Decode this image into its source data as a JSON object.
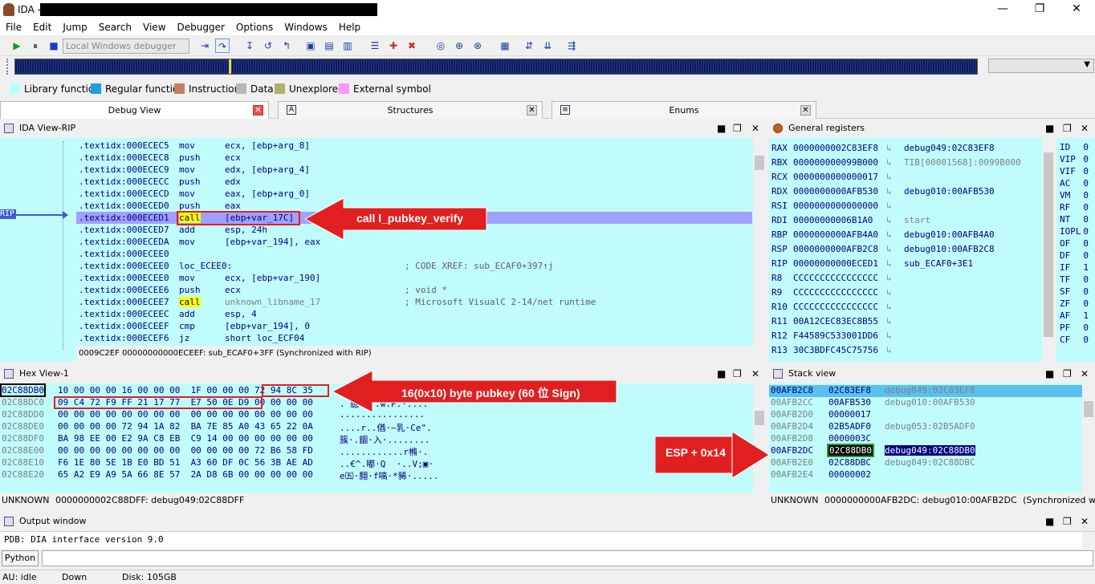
{
  "window": {
    "title": "IDA -",
    "minimize": "—",
    "maximize": "❐",
    "close": "✕"
  },
  "menu": [
    "File",
    "Edit",
    "Jump",
    "Search",
    "View",
    "Debugger",
    "Options",
    "Windows",
    "Help"
  ],
  "toolbar": {
    "debugger_select": "Local Windows debugger"
  },
  "legend": [
    {
      "label": "Library function",
      "color": "#b8ffff"
    },
    {
      "label": "Regular function",
      "color": "#1aa0e0"
    },
    {
      "label": "Instruction",
      "color": "#c08060"
    },
    {
      "label": "Data",
      "color": "#b8b8b8"
    },
    {
      "label": "Unexplored",
      "color": "#b0b070"
    },
    {
      "label": "External symbol",
      "color": "#ff98f8"
    }
  ],
  "tabs": [
    {
      "label": "Debug View"
    },
    {
      "label": "Structures"
    },
    {
      "label": "Enums"
    }
  ],
  "ida_view": {
    "title": "IDA View-RIP",
    "rip_label": "RIP",
    "lines": [
      {
        "addr": ".textidx:000ECEC5",
        "mn": "mov",
        "op": "ecx, [ebp+arg_8]",
        "cm": ""
      },
      {
        "addr": ".textidx:000ECEC8",
        "mn": "push",
        "op": "ecx",
        "cm": ""
      },
      {
        "addr": ".textidx:000ECEC9",
        "mn": "mov",
        "op": "edx, [ebp+arg_4]",
        "cm": ""
      },
      {
        "addr": ".textidx:000ECECC",
        "mn": "push",
        "op": "edx",
        "cm": ""
      },
      {
        "addr": ".textidx:000ECECD",
        "mn": "mov",
        "op": "eax, [ebp+arg_0]",
        "cm": ""
      },
      {
        "addr": ".textidx:000ECED0",
        "mn": "push",
        "op": "eax",
        "cm": ""
      },
      {
        "addr": ".textidx:000ECED1",
        "mn": "call",
        "op": "[ebp+var_17C]",
        "cm": ""
      },
      {
        "addr": ".textidx:000ECED7",
        "mn": "add",
        "op": "esp, 24h",
        "cm": ""
      },
      {
        "addr": ".textidx:000ECEDA",
        "mn": "mov",
        "op": "[ebp+var_194], eax",
        "cm": ""
      },
      {
        "addr": ".textidx:000ECEE0",
        "mn": "",
        "op": "",
        "cm": ""
      },
      {
        "addr": ".textidx:000ECEE0",
        "mn": "loc_ECEE0:",
        "op": "",
        "cm": "; CODE XREF: sub_ECAF0+397↑j"
      },
      {
        "addr": ".textidx:000ECEE0",
        "mn": "mov",
        "op": "ecx, [ebp+var_190]",
        "cm": ""
      },
      {
        "addr": ".textidx:000ECEE6",
        "mn": "push",
        "op": "ecx",
        "cm": "; void *"
      },
      {
        "addr": ".textidx:000ECEE7",
        "mn": "call",
        "op": "unknown_libname_17",
        "cm": "; Microsoft VisualC 2-14/net runtime"
      },
      {
        "addr": ".textidx:000ECEEC",
        "mn": "add",
        "op": "esp, 4",
        "cm": ""
      },
      {
        "addr": ".textidx:000ECEEF",
        "mn": "cmp",
        "op": "[ebp+var_194], 0",
        "cm": ""
      },
      {
        "addr": ".textidx:000ECEF6",
        "mn": "jz",
        "op": "short loc_ECF04",
        "cm": ""
      }
    ],
    "status": "0009C2EF 00000000000ECEEF: sub_ECAF0+3FF (Synchronized with RIP)"
  },
  "annotations": {
    "call_note": "call l_pubkey_verify",
    "hex_note": "16(0x10) byte pubkey (60 位 Sign)",
    "stack_note": "ESP + 0x14"
  },
  "registers": {
    "title": "General registers",
    "rows": [
      {
        "name": "RAX",
        "value": "0000000002C83EF8",
        "sym": "debug049:02C83EF8"
      },
      {
        "name": "RBX",
        "value": "000000000099B000",
        "sym": "TIB[00001568]:0099B000"
      },
      {
        "name": "RCX",
        "value": "0000000000000017",
        "sym": ""
      },
      {
        "name": "RDX",
        "value": "0000000000AFB530",
        "sym": "debug010:00AFB530"
      },
      {
        "name": "RSI",
        "value": "0000000000000000",
        "sym": ""
      },
      {
        "name": "RDI",
        "value": "00000000006B1A0",
        "sym": "start"
      },
      {
        "name": "RBP",
        "value": "0000000000AFB4A0",
        "sym": "debug010:00AFB4A0"
      },
      {
        "name": "RSP",
        "value": "0000000000AFB2C8",
        "sym": "debug010:00AFB2C8"
      },
      {
        "name": "RIP",
        "value": "00000000000ECED1",
        "sym": "sub_ECAF0+3E1"
      },
      {
        "name": "R8",
        "value": "CCCCCCCCCCCCCCCC",
        "sym": ""
      },
      {
        "name": "R9",
        "value": "CCCCCCCCCCCCCCCC",
        "sym": ""
      },
      {
        "name": "R10",
        "value": "CCCCCCCCCCCCCCCC",
        "sym": ""
      },
      {
        "name": "R11",
        "value": "00A12CEC83EC8B55",
        "sym": ""
      },
      {
        "name": "R12",
        "value": "F44589C533001DD6",
        "sym": ""
      },
      {
        "name": "R13",
        "value": "30C3BDFC45C75756",
        "sym": ""
      }
    ],
    "arrow": "↳"
  },
  "flags": [
    {
      "name": "ID",
      "value": "0"
    },
    {
      "name": "VIP",
      "value": "0"
    },
    {
      "name": "VIF",
      "value": "0"
    },
    {
      "name": "AC",
      "value": "0"
    },
    {
      "name": "VM",
      "value": "0"
    },
    {
      "name": "RF",
      "value": "0"
    },
    {
      "name": "NT",
      "value": "0"
    },
    {
      "name": "IOPL",
      "value": "0"
    },
    {
      "name": "OF",
      "value": "0"
    },
    {
      "name": "DF",
      "value": "0"
    },
    {
      "name": "IF",
      "value": "1"
    },
    {
      "name": "TF",
      "value": "0"
    },
    {
      "name": "SF",
      "value": "0"
    },
    {
      "name": "ZF",
      "value": "0"
    },
    {
      "name": "AF",
      "value": "1"
    },
    {
      "name": "PF",
      "value": "0"
    },
    {
      "name": "CF",
      "value": "0"
    }
  ],
  "hex_view": {
    "title": "Hex View-1",
    "rows": [
      {
        "addr": "02C88DB0",
        "bytes": "10 00 00 00 16 00 00 00  1F 00 00 00 72 94 8C 35",
        "chars": ""
      },
      {
        "addr": "02C88DC0",
        "bytes": "09 C4 72 F9 FF 21 17 77  E7 50 0E D9 00 00 00 00",
        "chars": ". 臆·.!.w.P.·...."
      },
      {
        "addr": "02C88DD0",
        "bytes": "00 00 00 00 00 00 00 00  00 00 00 00 00 00 00 00",
        "chars": "................"
      },
      {
        "addr": "02C88DE0",
        "bytes": "00 00 00 00 72 94 1A 82  BA 7E 85 A0 43 65 22 0A",
        "chars": "....r..偤·~乳·Ce\"."
      },
      {
        "addr": "02C88DF0",
        "bytes": "BA 98 EE 00 E2 9A C8 EB  C9 14 00 00 00 00 00 00",
        "chars": "簇·.錮·入·........"
      },
      {
        "addr": "02C88E00",
        "bytes": "00 00 00 00 00 00 00 00  00 00 00 00 72 B6 58 FD",
        "chars": "............r樇·."
      },
      {
        "addr": "02C88E10",
        "bytes": "F6 1E 80 5E 1B E0 BD 51  A3 60 DF 0C 56 3B AE AD",
        "chars": "..€^.嘟·Q  ·..V;▣·"
      },
      {
        "addr": "02C88E20",
        "bytes": "65 A2 E9 A9 5A 66 8E 57  2A D8 6B 00 00 00 00 00",
        "chars": "e㈤·翲·f嗃·*豨·....."
      }
    ],
    "status_left": "UNKNOWN",
    "status": "0000000002C88DFF: debug049:02C88DFF"
  },
  "stack_view": {
    "title": "Stack view",
    "rows": [
      {
        "addr": "00AFB2C8",
        "value": "02C83EF8",
        "sym": "debug049:02C83EF8"
      },
      {
        "addr": "00AFB2CC",
        "value": "00AFB530",
        "sym": "debug010:00AFB530"
      },
      {
        "addr": "00AFB2D0",
        "value": "00000017",
        "sym": ""
      },
      {
        "addr": "00AFB2D4",
        "value": "02B5ADF0",
        "sym": "debug053:02B5ADF0"
      },
      {
        "addr": "00AFB2D8",
        "value": "0000003C",
        "sym": ""
      },
      {
        "addr": "00AFB2DC",
        "value": "02C88DB0",
        "sym": "debug049:02C88DB0"
      },
      {
        "addr": "00AFB2E0",
        "value": "02C88DBC",
        "sym": "debug049:02C88DBC"
      },
      {
        "addr": "00AFB2E4",
        "value": "00000002",
        "sym": ""
      }
    ],
    "status_left": "UNKNOWN",
    "status": "0000000000AFB2DC: debug010:00AFB2DC",
    "status_right": "(Synchronized with RSP)"
  },
  "output": {
    "title": "Output window",
    "line": "PDB: DIA interface version 9.0"
  },
  "python": {
    "label": "Python"
  },
  "statusbar": {
    "au": "AU:",
    "au_value": "idle",
    "direction": "Down",
    "disk": "Disk: 105GB"
  }
}
